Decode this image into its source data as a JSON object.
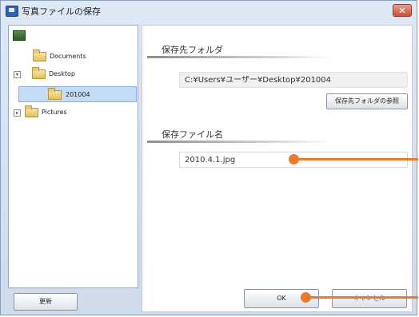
{
  "window": {
    "title": "写真ファイルの保存",
    "close_label": "✕"
  },
  "tree": {
    "items": [
      {
        "label": "Documents"
      },
      {
        "label": "Desktop",
        "expander": "▾"
      },
      {
        "label": "201004"
      },
      {
        "label": "Pictures",
        "expander": "▸"
      }
    ]
  },
  "buttons": {
    "refresh": "更新",
    "browse": "保存先フォルダの参照",
    "ok": "OK",
    "cancel": "キャンセル"
  },
  "save_folder": {
    "heading": "保存先フォルダ",
    "path": "C:¥Users¥ユーザー¥Desktop¥201004"
  },
  "file_name": {
    "heading": "保存ファイル名",
    "value": "2010.4.1.jpg"
  },
  "colors": {
    "callout": "#ea7a2c",
    "selection": "#c5dcf6"
  }
}
